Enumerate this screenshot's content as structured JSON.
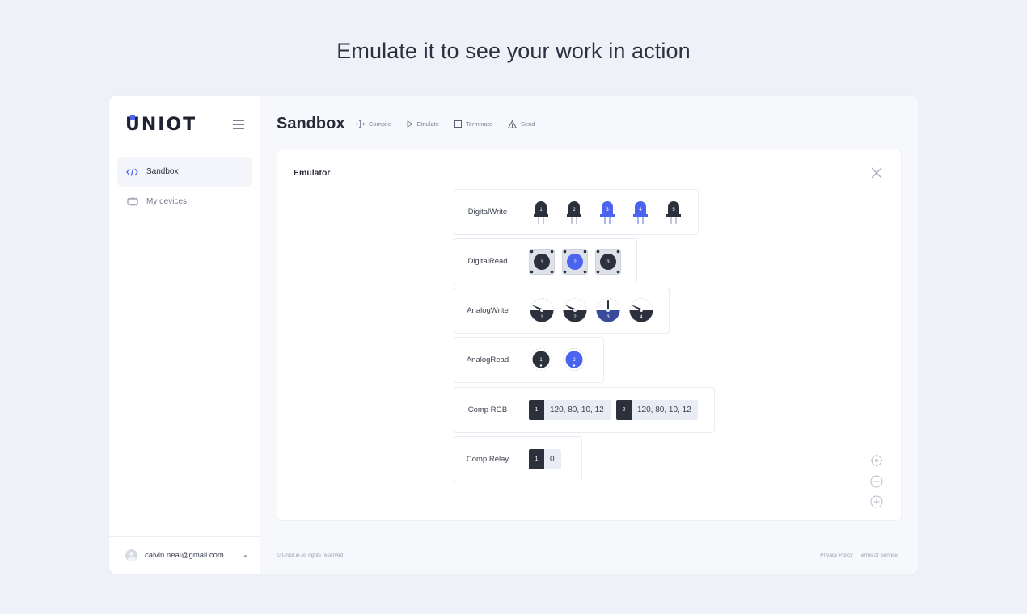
{
  "headline": "Emulate it to see your work in action",
  "brand": {
    "logo_text": "UNIOT",
    "accent": "#4a64f0"
  },
  "sidebar": {
    "items": [
      {
        "label": "Sandbox",
        "icon": "code-icon",
        "active": true
      },
      {
        "label": "My devices",
        "icon": "chip-icon",
        "active": false
      }
    ],
    "user": {
      "email": "calvin.neal@gmail.com"
    }
  },
  "page": {
    "title": "Sandbox"
  },
  "toolbar": {
    "compile": "Compile",
    "emulate": "Emulate",
    "terminate": "Terminate",
    "send": "Send"
  },
  "emulator": {
    "title": "Emulator",
    "digital_write": {
      "label": "DigitalWrite",
      "leds": [
        {
          "n": "1",
          "on": false
        },
        {
          "n": "2",
          "on": false
        },
        {
          "n": "3",
          "on": true
        },
        {
          "n": "4",
          "on": true
        },
        {
          "n": "5",
          "on": false
        }
      ]
    },
    "digital_read": {
      "label": "DigitalRead",
      "buttons": [
        {
          "n": "1",
          "on": false
        },
        {
          "n": "2",
          "on": true
        },
        {
          "n": "3",
          "on": false
        }
      ]
    },
    "analog_write": {
      "label": "AnalogWrite",
      "gauges": [
        {
          "n": "1",
          "on": false
        },
        {
          "n": "2",
          "on": false
        },
        {
          "n": "3",
          "on": true
        },
        {
          "n": "4",
          "on": false
        }
      ]
    },
    "analog_read": {
      "label": "AnalogRead",
      "knobs": [
        {
          "n": "1",
          "on": false
        },
        {
          "n": "2",
          "on": true
        }
      ]
    },
    "comp_rgb": {
      "label": "Comp RGB",
      "items": [
        {
          "n": "1",
          "value": "120, 80, 10, 12"
        },
        {
          "n": "2",
          "value": "120, 80, 10, 12"
        }
      ]
    },
    "comp_relay": {
      "label": "Comp Relay",
      "items": [
        {
          "n": "1",
          "value": "0"
        }
      ]
    }
  },
  "footer": {
    "copyright": "© Uniot.io All rights reserved",
    "privacy": "Privacy Policy",
    "terms": "Terms of Service"
  },
  "colors": {
    "on": "#4a64f0",
    "off": "#2c2f3c",
    "on_dark": "#3a4a9a",
    "leg_on": "#aab7f5",
    "leg_off": "#c4c8d4"
  }
}
